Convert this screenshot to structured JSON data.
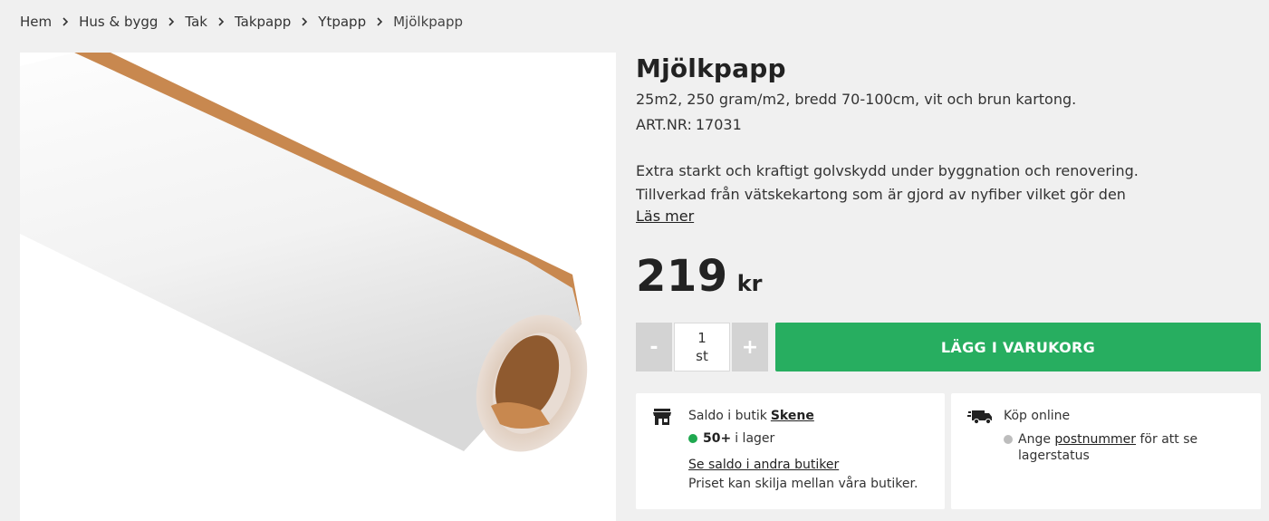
{
  "breadcrumb": [
    "Hem",
    "Hus & bygg",
    "Tak",
    "Takpapp",
    "Ytpapp",
    "Mjölkpapp"
  ],
  "product": {
    "title": "Mjölkpapp",
    "subtitle": "25m2, 250 gram/m2, bredd 70-100cm, vit och brun kartong.",
    "artnr_label": "ART.NR:",
    "artnr": "17031",
    "description": "Extra starkt och kraftigt golvskydd under byggnation och renovering. Tillverkad från vätskekartong som är gjord av nyfiber vilket gör den mycket stark och",
    "read_more": "Läs mer",
    "price": "219",
    "price_unit": "kr"
  },
  "purchase": {
    "minus": "-",
    "plus": "+",
    "quantity": "1",
    "quantity_unit": "st",
    "add_to_cart": "LÄGG I VARUKORG"
  },
  "store": {
    "label": "Saldo i butik",
    "store_name": "Skene",
    "stock_count": "50+",
    "stock_text": "i lager",
    "other_stores": "Se saldo i andra butiker",
    "price_note": "Priset kan skilja mellan våra butiker.",
    "icon": "store-icon"
  },
  "online": {
    "label": "Köp online",
    "prefix": "Ange",
    "link": "postnummer",
    "suffix": "för att se lagerstatus",
    "icon": "truck-icon"
  },
  "colors": {
    "background": "#f0f0f0",
    "accent_green": "#27ae60",
    "stock_dot": "#1fa84f",
    "unknown_dot": "#bdbdbd"
  }
}
